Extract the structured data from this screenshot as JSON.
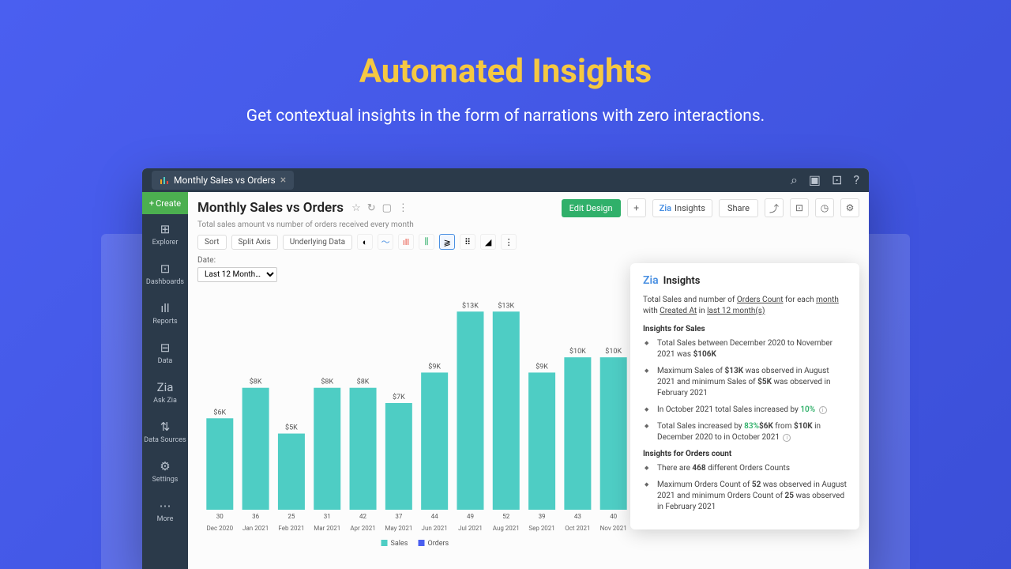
{
  "hero": {
    "title": "Automated Insights",
    "subtitle": "Get contextual insights in the form of narrations with zero interactions."
  },
  "tab": {
    "label": "Monthly Sales vs Orders"
  },
  "sidebar": {
    "create": "Create",
    "items": [
      {
        "icon": "⊞",
        "label": "Explorer"
      },
      {
        "icon": "⊡",
        "label": "Dashboards"
      },
      {
        "icon": "ıll",
        "label": "Reports"
      },
      {
        "icon": "⊟",
        "label": "Data"
      },
      {
        "icon": "Zia",
        "label": "Ask Zia"
      },
      {
        "icon": "⇅",
        "label": "Data Sources"
      },
      {
        "icon": "⚙",
        "label": "Settings"
      },
      {
        "icon": "⋯",
        "label": "More"
      }
    ]
  },
  "page": {
    "title": "Monthly Sales vs Orders",
    "subtitle": "Total sales amount vs number of orders received every month",
    "edit": "Edit Design",
    "insights_btn": "Insights",
    "share": "Share"
  },
  "toolbar": {
    "sort": "Sort",
    "split": "Split Axis",
    "underlying": "Underlying Data"
  },
  "date": {
    "label": "Date:",
    "selected": "Last 12 Month…"
  },
  "chart_data": {
    "type": "bar",
    "title": "Monthly Sales vs Orders",
    "xlabel": "",
    "ylabel": "",
    "ylim": [
      0,
      14
    ],
    "categories": [
      "Dec 2020",
      "Jan 2021",
      "Feb 2021",
      "Mar 2021",
      "Apr 2021",
      "May 2021",
      "Jun 2021",
      "Jul 2021",
      "Aug 2021",
      "Sep 2021",
      "Oct 2021",
      "Nov 2021"
    ],
    "series": [
      {
        "name": "Sales",
        "unit": "$K",
        "values": [
          6,
          8,
          5,
          8,
          8,
          7,
          9,
          13,
          13,
          9,
          10,
          10
        ],
        "labels": [
          "$6K",
          "$8K",
          "$5K",
          "$8K",
          "$8K",
          "$7K",
          "$9K",
          "$13K",
          "$13K",
          "$9K",
          "$10K",
          "$10K"
        ],
        "color": "#4ecdc4"
      },
      {
        "name": "Orders",
        "values": [
          30,
          36,
          25,
          31,
          42,
          37,
          44,
          49,
          52,
          39,
          43,
          40
        ],
        "color": "#4a5ff0"
      }
    ],
    "legend": [
      "Sales",
      "Orders"
    ]
  },
  "insights": {
    "title": "Insights",
    "summary_parts": [
      "Total Sales and number of ",
      "Orders Count",
      " for each ",
      "month",
      " with ",
      "Created At",
      " in ",
      "last 12 month(s)"
    ],
    "section1": "Insights for Sales",
    "sales": [
      {
        "text": "Total Sales between December 2020 to November 2021 was ",
        "bold": "$106K"
      },
      {
        "text": "Maximum Sales of ",
        "bold": "$13K",
        "text2": " was observed in August 2021 and minimum Sales of ",
        "bold2": "$5K",
        "text3": " was observed in February 2021"
      },
      {
        "text": "In October 2021 total Sales increased by ",
        "pct": "10%",
        "info": true
      },
      {
        "text": "Total Sales increased by ",
        "pct": "83%",
        "text2": " from ",
        "bold": "$6K",
        "text3": " in December 2020 to ",
        "bold2": "$10K",
        "text4": " in October 2021",
        "info": true
      }
    ],
    "section2": "Insights for Orders count",
    "orders": [
      {
        "text": "There are ",
        "bold": "468",
        "text2": " different Orders Counts"
      },
      {
        "text": "Maximum Orders Count of ",
        "bold": "52",
        "text2": " was observed in August 2021 and minimum Orders Count of ",
        "bold2": "25",
        "text3": " was observed in February 2021"
      }
    ]
  }
}
